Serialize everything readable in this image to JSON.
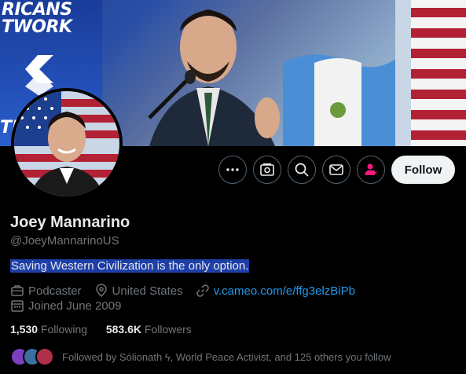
{
  "banner": {
    "sign_text": "RICANS\nTWORK",
    "sign_bottom": "TI"
  },
  "profile": {
    "name": "Joey Mannarino",
    "handle": "@JoeyMannarinoUS",
    "bio": "Saving Western Civilization is the only option.",
    "category": "Podcaster",
    "location": "United States",
    "link": "v.cameo.com/e/ffg3elzBiPb",
    "joined": "Joined June 2009"
  },
  "stats": {
    "following_count": "1,530",
    "following_label": "Following",
    "followers_count": "583.6K",
    "followers_label": "Followers"
  },
  "followed_by": "Followed by Sólionath ϟ, World Peace Activist, and 125 others you follow",
  "actions": {
    "follow_label": "Follow",
    "icons": [
      "more-icon",
      "subscribe-icon",
      "search-icon",
      "message-icon",
      "notify-icon"
    ]
  },
  "colors": {
    "accent": "#1d9bf0",
    "bio_highlight": "#1e3ea8",
    "notify": "#f91880"
  }
}
